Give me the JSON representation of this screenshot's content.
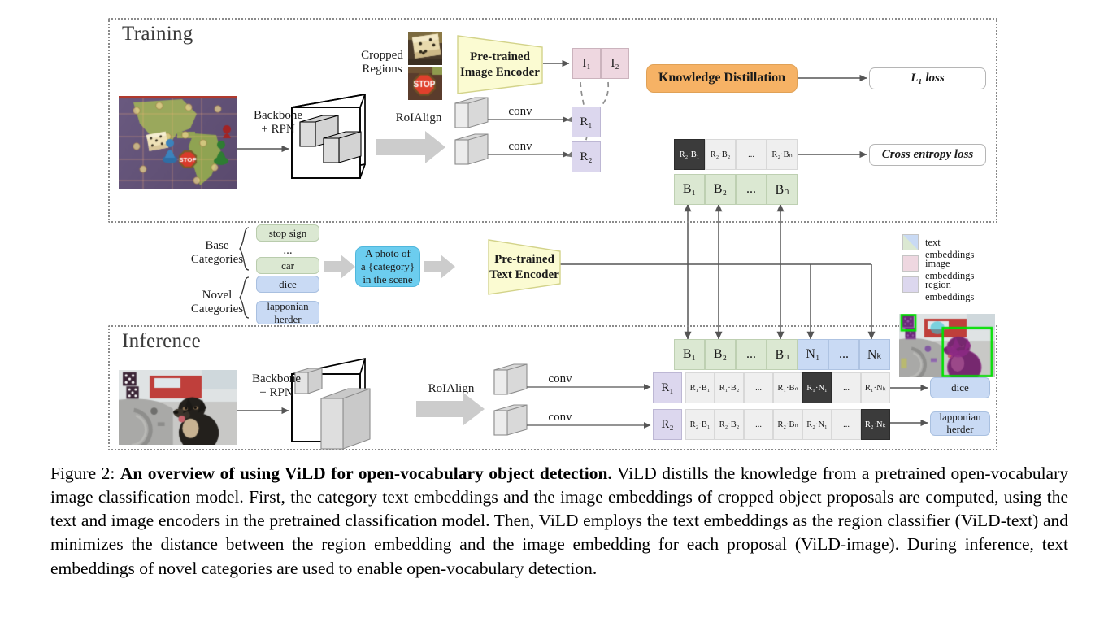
{
  "figure": {
    "number": "Figure 2:",
    "title_bold": "An overview of using ViLD for open-vocabulary object detection.",
    "caption_rest": " ViLD distills the knowledge from a pretrained open-vocabulary image classification model. First, the category text embeddings and the image embeddings of cropped object proposals are computed, using the text and image encoders in the pretrained classification model. Then, ViLD employs the text embeddings as the region classifier (ViLD-text) and minimizes the distance between the region embedding and the image embedding for each proposal (ViLD-image). During inference, text embeddings of novel categories are used to enable open-vocabulary detection."
  },
  "training": {
    "panel_title": "Training",
    "cropped_regions_label": "Cropped\nRegions",
    "cropped_regions_line1": "Cropped",
    "cropped_regions_line2": "Regions",
    "backbone_line1": "Backbone",
    "backbone_line2": "+ RPN",
    "roialign_label": "RoIAlign",
    "conv_label_1": "conv",
    "conv_label_2": "conv",
    "image_encoder_line1": "Pre-trained",
    "image_encoder_line2": "Image Encoder",
    "image_embeddings": [
      "I₁",
      "I₂"
    ],
    "region_embeddings": [
      "R₁",
      "R₂"
    ],
    "knowledge_distillation": "Knowledge Distillation",
    "l1_loss": "L₁ loss",
    "cross_entropy_loss": "Cross entropy loss",
    "score_row": [
      "R₂·B₁",
      "R₂·B₂",
      "...",
      "R₂·Bₙ"
    ],
    "score_row_highlight_index": 0,
    "text_row": [
      "B₁",
      "B₂",
      "...",
      "Bₙ"
    ]
  },
  "categories": {
    "base_label_line1": "Base",
    "base_label_line2": "Categories",
    "novel_label_line1": "Novel",
    "novel_label_line2": "Categories",
    "base_items": [
      "stop sign",
      "...",
      "car"
    ],
    "novel_items": [
      "dice",
      "...",
      "lapponian\nherder"
    ],
    "novel_item_last_line1": "lapponian",
    "novel_item_last_line2": "herder",
    "prompt_line1": "A photo of",
    "prompt_line2": "a {category}",
    "prompt_line3": "in the scene",
    "text_encoder_line1": "Pre-trained",
    "text_encoder_line2": "Text Encoder"
  },
  "legend": {
    "items": [
      {
        "label": "text embeddings",
        "color": "#dbe8d2",
        "color2": "#c9daf4",
        "split": true
      },
      {
        "label": "image embeddings",
        "color": "#eed7e0",
        "split": false
      },
      {
        "label": "region embeddings",
        "color": "#dcd7ee",
        "split": false
      }
    ]
  },
  "inference": {
    "panel_title": "Inference",
    "backbone_line1": "Backbone",
    "backbone_line2": "+ RPN",
    "roialign_label": "RoIAlign",
    "conv_label_1": "conv",
    "conv_label_2": "conv",
    "region_embeddings": [
      "R₁",
      "R₂"
    ],
    "embedding_row": [
      "B₁",
      "B₂",
      "...",
      "Bₙ",
      "N₁",
      "...",
      "Nₖ"
    ],
    "embedding_row_kinds": [
      "base",
      "base",
      "base",
      "base",
      "novel",
      "novel",
      "novel"
    ],
    "score_row_1": [
      "R₁·B₁",
      "R₁·B₂",
      "...",
      "R₁·Bₙ",
      "R₁·N₁",
      "...",
      "R₁·Nₖ"
    ],
    "score_row_1_highlight_index": 4,
    "score_row_2": [
      "R₂·B₁",
      "R₂·B₂",
      "...",
      "R₂·Bₙ",
      "R₂·N₁",
      "...",
      "R₂·Nₖ"
    ],
    "score_row_2_highlight_index": 6,
    "prediction_1": "dice",
    "prediction_2_line1": "lapponian",
    "prediction_2_line2": "herder"
  },
  "colors": {
    "text_embedding": "#dbe8d2",
    "novel_embedding": "#c9daf4",
    "image_embedding": "#eed7e0",
    "region_embedding": "#dcd7ee",
    "knowledge_distillation": "#f6b265",
    "encoder_fill": "#fbfbd2",
    "prompt_fill": "#6ccdef",
    "highlight_dark": "#3b3b3b",
    "arrow": "#555555",
    "detection_box": "#00e000"
  }
}
